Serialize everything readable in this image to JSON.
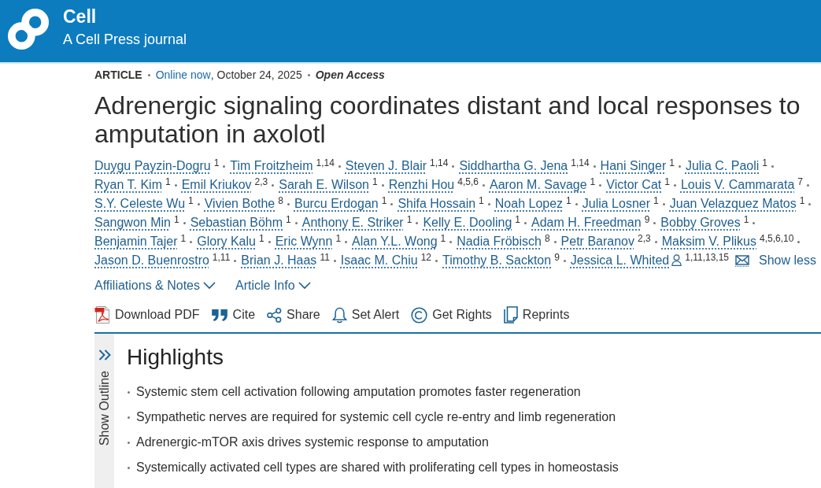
{
  "header": {
    "journal": "Cell",
    "tagline": "A Cell Press journal"
  },
  "article_meta": {
    "article_type": "ARTICLE",
    "status_link": "Online now",
    "date": ", October 24, 2025",
    "access": "Open Access"
  },
  "title": "Adrenergic signaling coordinates distant and local responses to amputation in axolotl",
  "authors": [
    {
      "name": "Duygu Payzin-Dogru",
      "affiliations": "1",
      "corresponding": false
    },
    {
      "name": "Tim Froitzheim",
      "affiliations": "1,14",
      "corresponding": false
    },
    {
      "name": "Steven J. Blair",
      "affiliations": "1,14",
      "corresponding": false
    },
    {
      "name": "Siddhartha G. Jena",
      "affiliations": "1,14",
      "corresponding": false
    },
    {
      "name": "Hani Singer",
      "affiliations": "1",
      "corresponding": false
    },
    {
      "name": "Julia C. Paoli",
      "affiliations": "1",
      "corresponding": false
    },
    {
      "name": "Ryan T. Kim",
      "affiliations": "1",
      "corresponding": false
    },
    {
      "name": "Emil Kriukov",
      "affiliations": "2,3",
      "corresponding": false
    },
    {
      "name": "Sarah E. Wilson",
      "affiliations": "1",
      "corresponding": false
    },
    {
      "name": "Renzhi Hou",
      "affiliations": "4,5,6",
      "corresponding": false
    },
    {
      "name": "Aaron M. Savage",
      "affiliations": "1",
      "corresponding": false
    },
    {
      "name": "Victor Cat",
      "affiliations": "1",
      "corresponding": false
    },
    {
      "name": "Louis V. Cammarata",
      "affiliations": "7",
      "corresponding": false
    },
    {
      "name": "S.Y. Celeste Wu",
      "affiliations": "1",
      "corresponding": false
    },
    {
      "name": "Vivien Bothe",
      "affiliations": "8",
      "corresponding": false
    },
    {
      "name": "Burcu Erdogan",
      "affiliations": "1",
      "corresponding": false
    },
    {
      "name": "Shifa Hossain",
      "affiliations": "1",
      "corresponding": false
    },
    {
      "name": "Noah Lopez",
      "affiliations": "1",
      "corresponding": false
    },
    {
      "name": "Julia Losner",
      "affiliations": "1",
      "corresponding": false
    },
    {
      "name": "Juan Velazquez Matos",
      "affiliations": "1",
      "corresponding": false
    },
    {
      "name": "Sangwon Min",
      "affiliations": "1",
      "corresponding": false
    },
    {
      "name": "Sebastian Böhm",
      "affiliations": "1",
      "corresponding": false
    },
    {
      "name": "Anthony E. Striker",
      "affiliations": "1",
      "corresponding": false
    },
    {
      "name": "Kelly E. Dooling",
      "affiliations": "1",
      "corresponding": false
    },
    {
      "name": "Adam H. Freedman",
      "affiliations": "9",
      "corresponding": false
    },
    {
      "name": "Bobby Groves",
      "affiliations": "1",
      "corresponding": false
    },
    {
      "name": "Benjamin Tajer",
      "affiliations": "1",
      "corresponding": false
    },
    {
      "name": "Glory Kalu",
      "affiliations": "1",
      "corresponding": false
    },
    {
      "name": "Eric Wynn",
      "affiliations": "1",
      "corresponding": false
    },
    {
      "name": "Alan Y.L. Wong",
      "affiliations": "1",
      "corresponding": false
    },
    {
      "name": "Nadia Fröbisch",
      "affiliations": "8",
      "corresponding": false
    },
    {
      "name": "Petr Baranov",
      "affiliations": "2,3",
      "corresponding": false
    },
    {
      "name": "Maksim V. Plikus",
      "affiliations": "4,5,6,10",
      "corresponding": false
    },
    {
      "name": "Jason D. Buenrostro",
      "affiliations": "1,11",
      "corresponding": false
    },
    {
      "name": "Brian J. Haas",
      "affiliations": "11",
      "corresponding": false
    },
    {
      "name": "Isaac M. Chiu",
      "affiliations": "12",
      "corresponding": false
    },
    {
      "name": "Timothy B. Sackton",
      "affiliations": "9",
      "corresponding": false
    },
    {
      "name": "Jessica L. Whited",
      "affiliations": "1,11,13,15",
      "corresponding": true
    }
  ],
  "author_toggle": "Show less",
  "info_links": [
    {
      "label": "Affiliations & Notes",
      "expanded": false
    },
    {
      "label": "Article Info",
      "expanded": false
    }
  ],
  "toolbar": [
    {
      "kind": "pdf",
      "label": "Download PDF"
    },
    {
      "kind": "cite",
      "label": "Cite"
    },
    {
      "kind": "share",
      "label": "Share"
    },
    {
      "kind": "alert",
      "label": "Set Alert"
    },
    {
      "kind": "rights",
      "label": "Get Rights"
    },
    {
      "kind": "reprints",
      "label": "Reprints"
    }
  ],
  "outline": {
    "label": "Show Outline"
  },
  "highlights": {
    "title": "Highlights",
    "items": [
      "Systemic stem cell activation following amputation promotes faster regeneration",
      "Sympathetic nerves are required for systemic cell cycle re-entry and limb regeneration",
      "Adrenergic-mTOR axis drives systemic response to amputation",
      "Systemically activated cell types are shared with proliferating cell types in homeostasis"
    ]
  }
}
